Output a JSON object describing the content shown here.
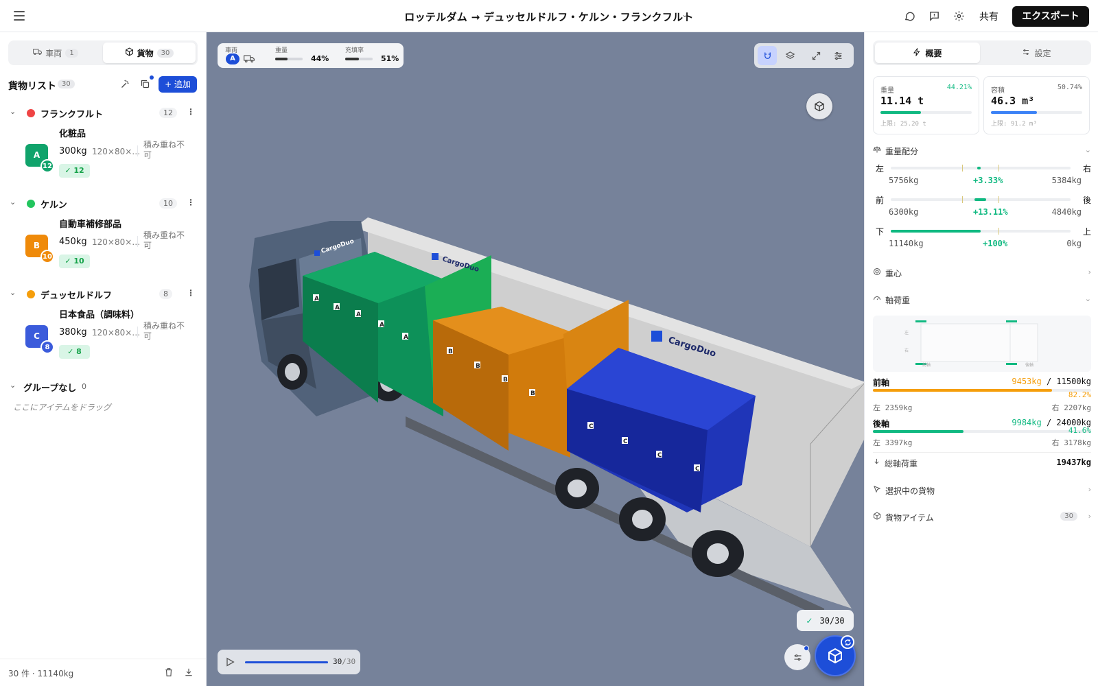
{
  "header": {
    "route_title": "ロッテルダム → デュッセルドルフ・ケルン・フランクフルト",
    "share_label": "共有",
    "export_label": "エクスポート"
  },
  "sidebar": {
    "tabs": [
      {
        "label": "車両",
        "count": "1"
      },
      {
        "label": "貨物",
        "count": "30"
      }
    ],
    "list_title": "貨物リスト",
    "list_count": "30",
    "add_label": "+ 追加",
    "groups": [
      {
        "name": "フランクフルト",
        "count": "12",
        "color": "#ef4444",
        "item": {
          "name": "化粧品",
          "avatar": "A",
          "badge": "12",
          "weight": "300kg",
          "dims": "120×80×…",
          "stack": "積み重ね不可",
          "placed": "✓ 12",
          "color": "#10a36b"
        }
      },
      {
        "name": "ケルン",
        "count": "10",
        "color": "#22c55e",
        "item": {
          "name": "自動車補修部品",
          "avatar": "B",
          "badge": "10",
          "weight": "450kg",
          "dims": "120×80×…",
          "stack": "積み重ね不可",
          "placed": "✓ 10",
          "color": "#ef8a0a"
        }
      },
      {
        "name": "デュッセルドルフ",
        "count": "8",
        "color": "#f59e0b",
        "item": {
          "name": "日本食品（調味料）",
          "avatar": "C",
          "badge": "8",
          "weight": "380kg",
          "dims": "120×80×…",
          "stack": "積み重ね不可",
          "placed": "✓ 8",
          "color": "#3b5bdb"
        }
      }
    ],
    "ungrouped": {
      "name": "グループなし",
      "count": "0",
      "drag_hint": "ここにアイテムをドラッグ"
    },
    "footer_summary": "30 件 · 11140kg"
  },
  "viewport": {
    "stats": {
      "vehicle_label": "車両",
      "vehicle_badge": "A",
      "weight_label": "重量",
      "weight_value": "44%",
      "weight_fraction": 0.44,
      "fill_label": "充填率",
      "fill_value": "51%",
      "fill_fraction": 0.51
    },
    "truck_brand": "CargoDuo",
    "box_labels": {
      "green": "A",
      "orange": "B",
      "blue": "C"
    },
    "placed_count": "30/30",
    "playback": {
      "current": "30",
      "total": "/30",
      "fraction": 1.0
    }
  },
  "right_panel": {
    "tabs": [
      {
        "label": "概要"
      },
      {
        "label": "設定"
      }
    ],
    "weight_card": {
      "label": "重量",
      "pct": "44.21%",
      "value": "11.14 t",
      "fraction": 0.4421,
      "limit": "上限: 25.20 t",
      "color": "#10b981"
    },
    "volume_card": {
      "label": "容積",
      "pct": "50.74%",
      "value": "46.3 m³",
      "fraction": 0.5074,
      "limit": "上限: 91.2 m³",
      "color": "#3b82f6"
    },
    "weight_distribution": {
      "title": "重量配分",
      "rows": [
        {
          "left_label": "左",
          "right_label": "右",
          "left_value": "5756kg",
          "balance": "+3.33%",
          "right_value": "5384kg"
        },
        {
          "left_label": "前",
          "right_label": "後",
          "left_value": "6300kg",
          "balance": "+13.11%",
          "right_value": "4840kg"
        },
        {
          "left_label": "下",
          "right_label": "上",
          "left_value": "11140kg",
          "balance": "+100%",
          "right_value": "0kg"
        }
      ]
    },
    "center_of_gravity": {
      "title": "重心"
    },
    "axle_load": {
      "title": "軸荷重",
      "diagram_labels": {
        "left": "左",
        "right": "右",
        "front": "前軸",
        "rear": "後軸"
      },
      "front": {
        "name": "前軸",
        "load": "9453kg",
        "sep": " / ",
        "limit": "11500kg",
        "pct": "82.2%",
        "fraction": 0.822,
        "left": "左 2359kg",
        "right": "右 2207kg",
        "color": "#f59e0b"
      },
      "rear": {
        "name": "後軸",
        "load": "9984kg",
        "sep": " / ",
        "limit": "24000kg",
        "pct": "41.6%",
        "fraction": 0.416,
        "left": "左 3397kg",
        "right": "右 3178kg",
        "color": "#10b981"
      },
      "total_label": "総軸荷重",
      "total_value": "19437kg"
    },
    "selected_cargo": {
      "title": "選択中の貨物"
    },
    "cargo_items": {
      "title": "貨物アイテム",
      "count": "30"
    }
  }
}
